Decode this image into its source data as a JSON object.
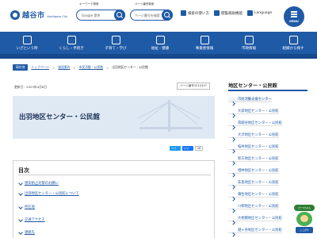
{
  "header": {
    "logo_text": "越谷市",
    "logo_sub": "Koshigaya City",
    "keyword_label": "キーワード検索",
    "keyword_placeholder": "Google 提供",
    "pageid_label": "ページ番号検索",
    "pageid_placeholder": "ページ番号を検索",
    "links": [
      {
        "label": "検索の使い方",
        "icon": "help-icon"
      },
      {
        "label": "閲覧補助機能",
        "icon": "accessibility-icon"
      },
      {
        "label": "Language",
        "icon": "globe-icon"
      }
    ],
    "menu_label": "MENU"
  },
  "nav": [
    {
      "label": "いざという時",
      "icon": "alert-icon"
    },
    {
      "label": "くらし・手続き",
      "icon": "house-icon"
    },
    {
      "label": "子育て・学び",
      "icon": "child-icon"
    },
    {
      "label": "福祉・健康",
      "icon": "heart-icon"
    },
    {
      "label": "事業者情報",
      "icon": "briefcase-icon"
    },
    {
      "label": "市政情報",
      "icon": "cityhall-icon"
    },
    {
      "label": "組織から探す",
      "icon": "org-icon"
    }
  ],
  "breadcrumb": {
    "home": "現在地",
    "items": [
      "トップページ",
      "施設案内",
      "市民活動・公民館"
    ],
    "current": "出羽地区センター・公民館"
  },
  "updated": "更新日：2023年4月6日",
  "page_id": "ページ番号1010397",
  "hero_title": "出羽地区センター・公民館",
  "share": {
    "tweet": "ツイート",
    "facebook": "いいね",
    "count": "26"
  },
  "toc": {
    "title": "目次",
    "items": [
      "感染防止対策のお願い",
      "出羽地区センター・公民館について",
      "所在地",
      "交通アクセス",
      "連絡先"
    ]
  },
  "sidebar": {
    "title": "地区センター・公民館",
    "items": [
      "市民活動支援センター",
      "大袋地区センター・公民館",
      "南越谷地区センター・公民館",
      "大沢地区センター・公民館",
      "桜井地区センター・公民館",
      "新方地区センター・公民館",
      "増林地区センター・公民館",
      "荻島地区センター・公民館",
      "蒲生地区センター・公民館",
      "川柳地区センター・公民館",
      "大相模地区センター・公民館",
      "越ヶ谷地区センター・公民館"
    ]
  },
  "mascot": {
    "badge": "ガーヤちゃん",
    "caption": "こしがや"
  },
  "colors": {
    "brand": "#1f5aa6",
    "hero_bg": "#dfe9f4"
  }
}
